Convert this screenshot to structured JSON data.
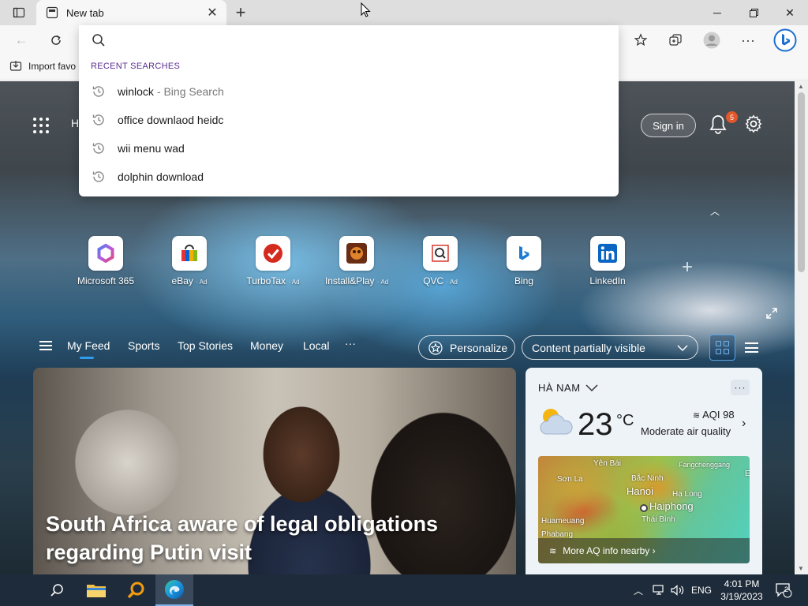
{
  "browser": {
    "tab_title": "New tab",
    "favorites_bar": {
      "import_label": "Import favo"
    }
  },
  "omnibox": {
    "placeholder": "",
    "header": "RECENT SEARCHES",
    "items": [
      {
        "text": "winlock",
        "suffix": "- Bing Search"
      },
      {
        "text": "office downlaod heidc",
        "suffix": ""
      },
      {
        "text": "wii menu wad",
        "suffix": ""
      },
      {
        "text": "dolphin download",
        "suffix": ""
      }
    ]
  },
  "newtab": {
    "hidden_heading_fragment": "H",
    "sign_in_label": "Sign in",
    "notification_count": "5",
    "quick_links": [
      {
        "label": "Microsoft 365",
        "ad": ""
      },
      {
        "label": "eBay",
        "ad": "· Ad"
      },
      {
        "label": "TurboTax",
        "ad": "· Ad"
      },
      {
        "label": "Install&Play",
        "ad": "· Ad"
      },
      {
        "label": "QVC",
        "ad": "· Ad"
      },
      {
        "label": "Bing",
        "ad": ""
      },
      {
        "label": "LinkedIn",
        "ad": ""
      }
    ],
    "feed_tabs": [
      "My Feed",
      "Sports",
      "Top Stories",
      "Money",
      "Local"
    ],
    "feed_more": "···",
    "personalize_label": "Personalize",
    "content_visibility": "Content partially visible",
    "hero": {
      "title": "South Africa aware of legal obligations regarding Putin visit"
    },
    "weather": {
      "location": "HÀ NAM",
      "temperature": "23",
      "unit": "°C",
      "aqi": "AQI 98",
      "aqi_desc": "Moderate air quality",
      "map_labels": [
        "Yên Bái",
        "Fangchenggang",
        "Sơn La",
        "Bắc Ninh",
        "Hanoi",
        "Hạ Long",
        "Haiphong",
        "Thái Bình",
        "Huameuang",
        "Phabang",
        "E"
      ],
      "map_footer": "More AQ info nearby ›",
      "more_label": "···"
    }
  },
  "taskbar": {
    "language": "ENG",
    "time": "4:01 PM",
    "date": "3/19/2023",
    "notification_count": "2"
  },
  "colors": {
    "accent": "#0078d4",
    "recent_header": "#5b2e91",
    "badge": "#e2572b"
  }
}
